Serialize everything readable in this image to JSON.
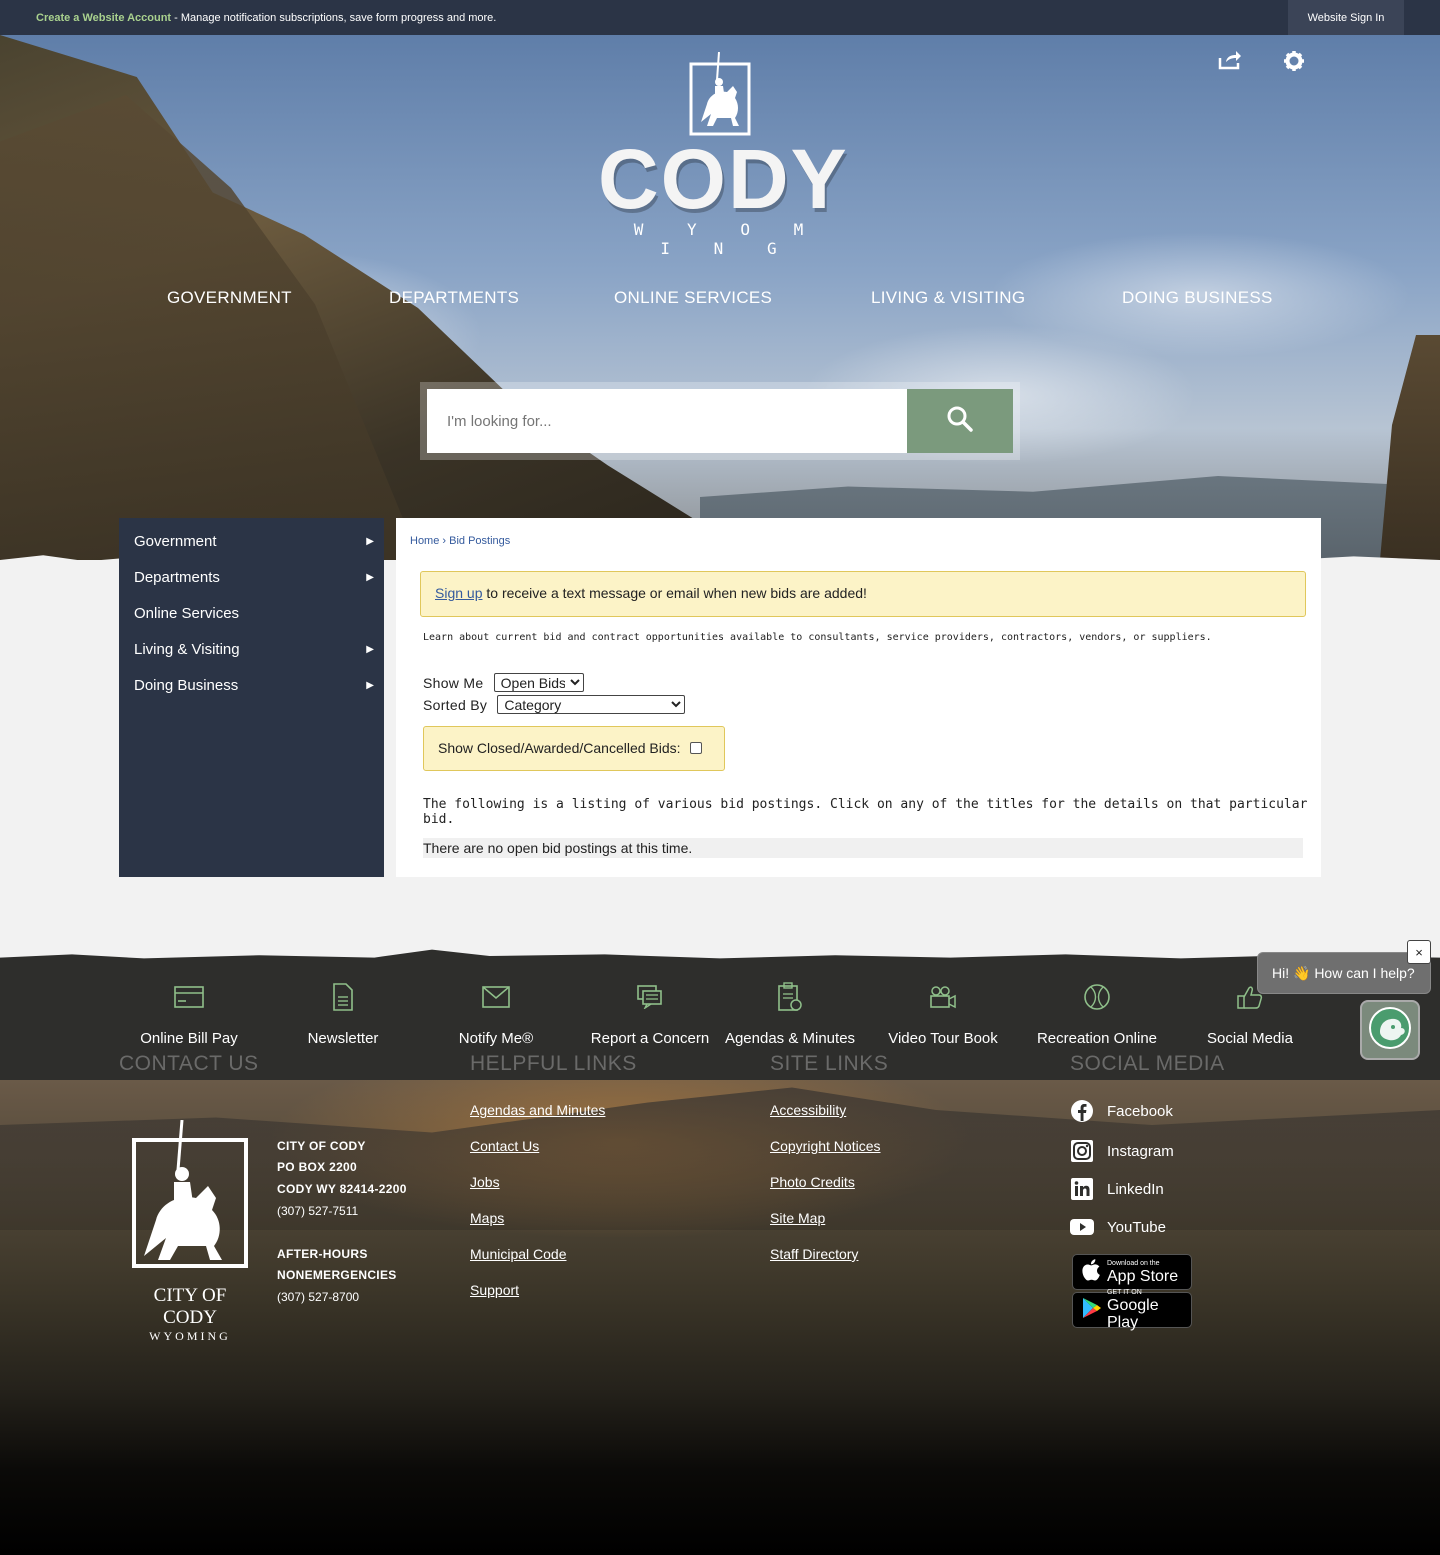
{
  "topbar": {
    "create_link": "Create a Website Account",
    "create_text": " - Manage notification subscriptions, save form progress and more.",
    "sign_in": "Website Sign In"
  },
  "header": {
    "logo_text": "CODY",
    "logo_subtext": "W Y O M I N G",
    "nav": [
      "GOVERNMENT",
      "DEPARTMENTS",
      "ONLINE SERVICES",
      "LIVING & VISITING",
      "DOING BUSINESS"
    ],
    "share_icon": "share-icon",
    "settings_icon": "gear-icon"
  },
  "search": {
    "placeholder": "I'm looking for..."
  },
  "sidebar": {
    "items": [
      {
        "label": "Government",
        "has_submenu": true
      },
      {
        "label": "Departments",
        "has_submenu": true
      },
      {
        "label": "Online Services",
        "has_submenu": false
      },
      {
        "label": "Living & Visiting",
        "has_submenu": true
      },
      {
        "label": "Doing Business",
        "has_submenu": true
      }
    ]
  },
  "content": {
    "breadcrumb_home": "Home",
    "breadcrumb_sep": " › ",
    "breadcrumb_current": "Bid Postings",
    "notice_link": "Sign up",
    "notice_text": " to receive a text message or email when new bids are added!",
    "learn_text": "Learn about current bid and contract opportunities available to consultants, service providers, contractors, vendors, or suppliers.",
    "show_me_label": "Show Me",
    "show_me_value": "Open Bids",
    "sorted_by_label": "Sorted By",
    "sorted_by_value": "Category",
    "closed_label": "Show Closed/Awarded/Cancelled Bids:",
    "listing_text": "The following is a listing of various bid postings. Click on any of the titles for the details on that particular bid.",
    "no_bids_text": "There are no open bid postings at this time."
  },
  "quick_links": [
    {
      "label": "Online Bill Pay",
      "icon": "credit-card-icon"
    },
    {
      "label": "Newsletter",
      "icon": "document-icon"
    },
    {
      "label": "Notify Me®",
      "icon": "envelope-icon"
    },
    {
      "label": "Report a Concern",
      "icon": "chat-bubbles-icon"
    },
    {
      "label": "Agendas & Minutes",
      "icon": "clipboard-clock-icon"
    },
    {
      "label": "Video Tour Book",
      "icon": "video-camera-icon"
    },
    {
      "label": "Recreation Online",
      "icon": "ball-icon"
    },
    {
      "label": "Social Media",
      "icon": "thumbs-up-icon"
    }
  ],
  "footer": {
    "contact_heading": "CONTACT US",
    "helpful_heading": "HELPFUL LINKS",
    "site_heading": "SITE LINKS",
    "social_heading": "SOCIAL MEDIA",
    "logo_line1": "CITY OF CODY",
    "logo_line2": "WYOMING",
    "address": {
      "name": "CITY OF CODY",
      "po_box": "PO BOX 2200",
      "city": "CODY WY 82414-2200",
      "phone": "(307) 527-7511",
      "after_hours_1": "AFTER-HOURS",
      "after_hours_2": "NONEMERGENCIES",
      "after_phone": "(307) 527-8700"
    },
    "helpful_links": [
      "Agendas and Minutes",
      "Contact Us",
      "Jobs",
      "Maps",
      "Municipal Code",
      "Support"
    ],
    "site_links": [
      "Accessibility",
      "Copyright Notices",
      "Photo Credits",
      "Site Map",
      "Staff Directory"
    ],
    "social_links": [
      {
        "label": "Facebook",
        "icon": "facebook-icon"
      },
      {
        "label": "Instagram",
        "icon": "instagram-icon"
      },
      {
        "label": "LinkedIn",
        "icon": "linkedin-icon"
      },
      {
        "label": "YouTube",
        "icon": "youtube-icon"
      }
    ],
    "app_store_small": "Download on the",
    "app_store_big": "App Store",
    "google_small": "GET IT ON",
    "google_big": "Google Play"
  },
  "chat": {
    "greeting": "Hi! 👋 How can I help?",
    "close": "×"
  },
  "colors": {
    "nav_bg": "#2b3446",
    "accent_green": "#7b9a7d",
    "notice_bg": "#fcf3c7",
    "link_blue": "#345a9d"
  }
}
